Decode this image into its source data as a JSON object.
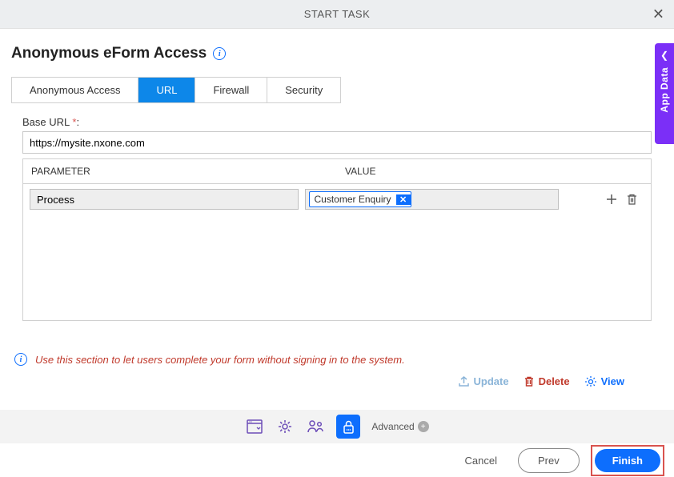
{
  "header": {
    "title": "START TASK"
  },
  "page": {
    "title": "Anonymous eForm Access"
  },
  "tabs": [
    {
      "label": "Anonymous Access"
    },
    {
      "label": "URL"
    },
    {
      "label": "Firewall"
    },
    {
      "label": "Security"
    }
  ],
  "form": {
    "base_url_label": "Base URL",
    "base_url_value": "https://mysite.nxone.com",
    "param_header": "PARAMETER",
    "value_header": "VALUE",
    "rows": [
      {
        "param": "Process",
        "value_chip": "Customer Enquiry"
      }
    ]
  },
  "hint": "Use this section to let users complete your form without signing in to the system.",
  "actions": {
    "update": "Update",
    "delete": "Delete",
    "view": "View"
  },
  "footer": {
    "advanced": "Advanced"
  },
  "bottom": {
    "cancel": "Cancel",
    "prev": "Prev",
    "finish": "Finish"
  },
  "side_tab": "App Data"
}
